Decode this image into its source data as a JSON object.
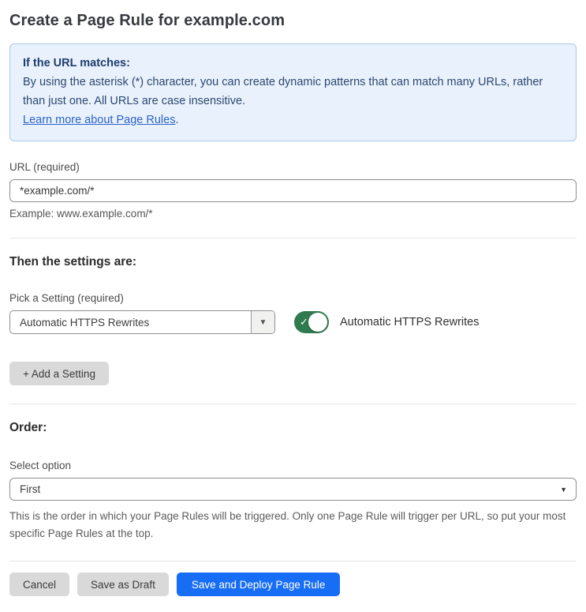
{
  "title": "Create a Page Rule for example.com",
  "info_box": {
    "heading": "If the URL matches:",
    "body": "By using the asterisk (*) character, you can create dynamic patterns that can match many URLs, rather than just one. All URLs are case insensitive.",
    "link_text": "Learn more about Page Rules",
    "link_suffix": "."
  },
  "url_field": {
    "label": "URL (required)",
    "value": "*example.com/*",
    "hint": "Example: www.example.com/*"
  },
  "settings_section": {
    "heading": "Then the settings are:",
    "picker_label": "Pick a Setting (required)",
    "picker_value": "Automatic HTTPS Rewrites",
    "toggle_state": "on",
    "toggle_label": "Automatic HTTPS Rewrites",
    "add_setting_label": "+ Add a Setting"
  },
  "order_section": {
    "heading": "Order:",
    "select_label": "Select option",
    "select_value": "First",
    "description": "This is the order in which your Page Rules will be triggered. Only one Page Rule will trigger per URL, so put your most specific Page Rules at the top."
  },
  "footer": {
    "cancel_label": "Cancel",
    "save_draft_label": "Save as Draft",
    "save_deploy_label": "Save and Deploy Page Rule"
  },
  "icons": {
    "dropdown_arrow": "▼",
    "toggle_check": "✓"
  },
  "colors": {
    "info_bg": "#e9f2fc",
    "info_border": "#a9c9e9",
    "info_text": "#2c4770",
    "link_blue": "#2c64c8",
    "toggle_green": "#2f7b4f",
    "primary_blue": "#186df5",
    "button_gray": "#d9d9d9"
  }
}
